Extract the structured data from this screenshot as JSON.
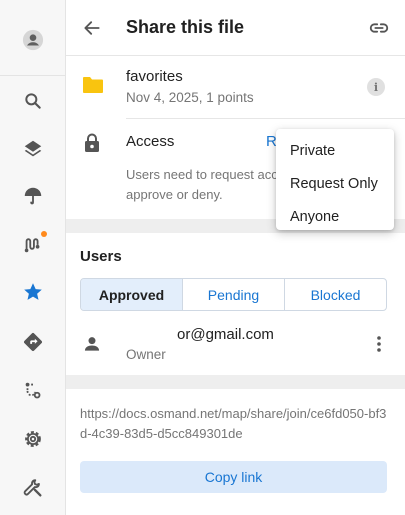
{
  "rail": {
    "items": [
      {
        "icon": "account-icon"
      },
      {
        "icon": "search-icon"
      },
      {
        "icon": "layers-icon"
      },
      {
        "icon": "weather-umbrella-icon"
      },
      {
        "icon": "tracks-icon",
        "badge_color": "#ff8a1c"
      },
      {
        "icon": "favorites-star-icon",
        "selected": true
      },
      {
        "icon": "directions-icon"
      },
      {
        "icon": "plan-route-icon"
      },
      {
        "icon": "settings-gear-icon"
      },
      {
        "icon": "tools-wrench-icon"
      }
    ]
  },
  "header": {
    "title": "Share this file",
    "back_icon": "arrow-back-icon",
    "link_icon": "link-icon"
  },
  "file": {
    "name": "favorites",
    "meta": "Nov 4, 2025, 1 points",
    "icon": "folder-icon",
    "info_icon": "info-icon",
    "info_glyph": "i"
  },
  "access": {
    "label": "Access",
    "value_partial": "R",
    "description_line1": "Users need to request acc",
    "description_line2": "approve or deny.",
    "icon": "lock-icon"
  },
  "access_menu": {
    "options": [
      "Private",
      "Request Only",
      "Anyone"
    ]
  },
  "users": {
    "title": "Users",
    "tabs": [
      {
        "label": "Approved",
        "active": true
      },
      {
        "label": "Pending",
        "active": false
      },
      {
        "label": "Blocked",
        "active": false
      }
    ],
    "list": [
      {
        "email": "or@gmail.com",
        "role": "Owner"
      }
    ]
  },
  "share": {
    "url": "https://docs.osmand.net/map/share/join/ce6fd050-bf3d-4c39-83d5-d5cc849301de",
    "copy_label": "Copy link"
  },
  "colors": {
    "accent": "#1976d2",
    "folder": "#f9c40f",
    "star": "#1976d2",
    "badge": "#ff8a1c"
  }
}
